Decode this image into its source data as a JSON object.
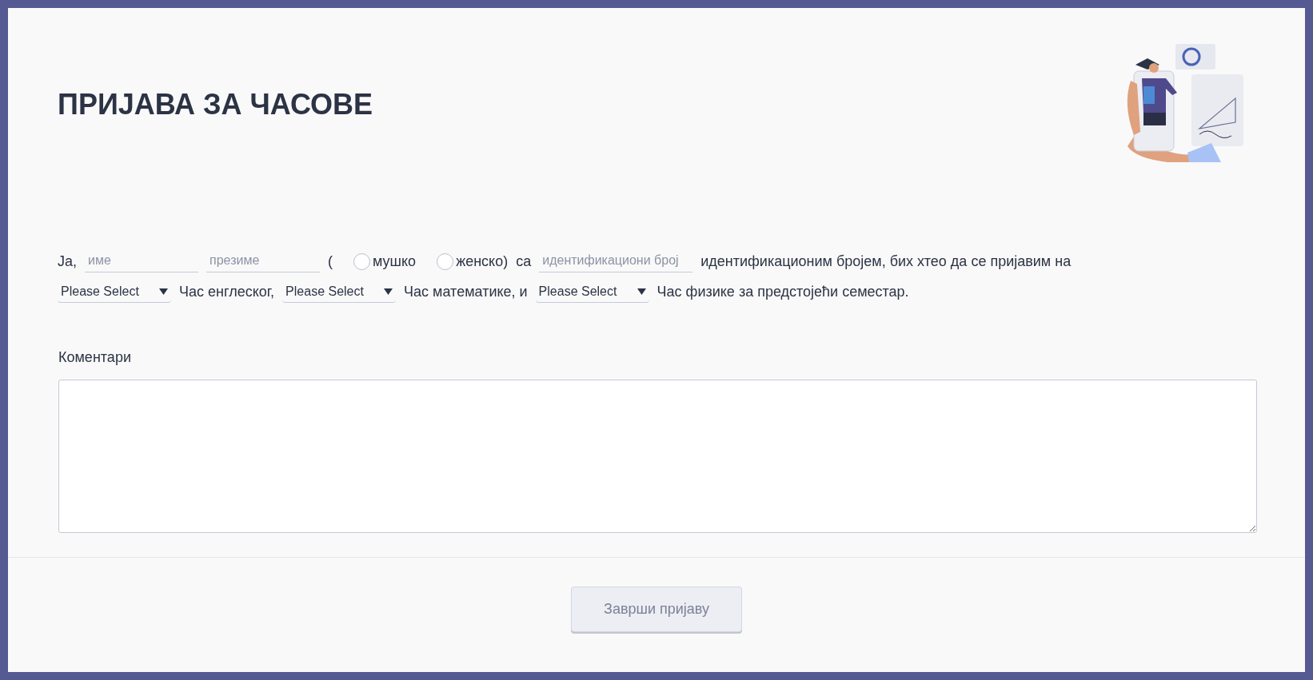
{
  "title": "ПРИЈАВА ЗА ЧАСОВЕ",
  "lines": [
    [
      {
        "kind": "text",
        "text": "Ја,"
      },
      {
        "kind": "input",
        "placeholder": "име"
      },
      {
        "kind": "input",
        "placeholder": "презиме"
      },
      {
        "kind": "text",
        "text": "("
      },
      {
        "kind": "radio",
        "label": "мушко",
        "selected": false
      },
      {
        "kind": "radio",
        "label": "женско)",
        "selected": false
      },
      {
        "kind": "text",
        "text": "са"
      },
      {
        "kind": "input",
        "placeholder": "идентификациони број"
      },
      {
        "kind": "text",
        "text": "идентификационим бројем, бих хтео да се пријавим на"
      }
    ],
    [
      {
        "kind": "select",
        "value": "Please Select"
      },
      {
        "kind": "text",
        "text": "Час енглеског,"
      },
      {
        "kind": "select",
        "value": "Please Select"
      },
      {
        "kind": "text",
        "text": "Час математике, и"
      },
      {
        "kind": "select",
        "value": "Please Select"
      },
      {
        "kind": "text",
        "text": "Час физике за предстојећи семестар."
      }
    ]
  ],
  "comments": {
    "label": "Коментари"
  },
  "submit": {
    "label": "Заврши пријаву"
  }
}
